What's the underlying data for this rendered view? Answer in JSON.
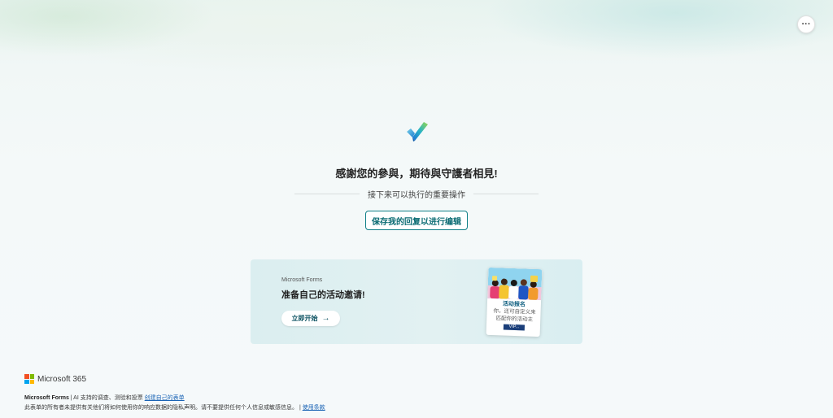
{
  "header": {
    "more_label": "···"
  },
  "confirmation": {
    "title": "感謝您的參與，期待與守護者相見!",
    "next_actions_label": "接下来可以执行的重要操作",
    "save_button_label": "保存我的回复以进行编辑"
  },
  "promo": {
    "brand": "Microsoft Forms",
    "title": "准备自己的活动邀请!",
    "start_button_label": "立即开始",
    "start_button_icon": "arrow-right-icon",
    "card": {
      "title": "活动报名",
      "text_line1": "你，还可自定义来",
      "text_line2": "匹配你的活动主",
      "highlight": "VIP..."
    }
  },
  "footer": {
    "brand": "Microsoft 365",
    "line1_product": "Microsoft Forms",
    "line1_text": " | AI 支持的调查、测验和投票 ",
    "line1_link": "创建自己的表单",
    "line2_text": "此表单的所有者未提供有关他们将如何使用你的响应数据的隐私声明。请不要提供任何个人信息或敏感信息。 | ",
    "line2_link": "使用条款"
  },
  "colors": {
    "accent": "#0f7f87",
    "link": "#1a64b5",
    "ms_red": "#f25022",
    "ms_green": "#7fba00",
    "ms_blue": "#00a4ef",
    "ms_yellow": "#ffb900"
  }
}
